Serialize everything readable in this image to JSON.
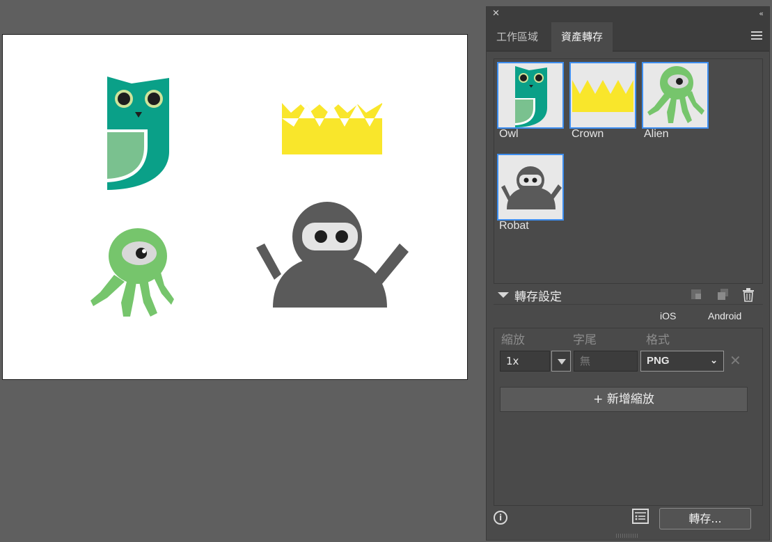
{
  "panel": {
    "tabs": [
      {
        "label": "工作區域",
        "active": false
      },
      {
        "label": "資產轉存",
        "active": true
      }
    ]
  },
  "assets": [
    {
      "label": "Owl",
      "icon": "owl"
    },
    {
      "label": "Crown",
      "icon": "crown"
    },
    {
      "label": "Alien",
      "icon": "alien"
    },
    {
      "label": "Robat",
      "icon": "robot"
    }
  ],
  "export_settings": {
    "title": "轉存設定",
    "platforms": [
      "iOS",
      "Android"
    ],
    "columns": {
      "scale": "縮放",
      "suffix": "字尾",
      "format": "格式"
    },
    "scale_value": "1x",
    "suffix_placeholder": "無",
    "format_value": "PNG",
    "add_scale_label": "+ 新增縮放"
  },
  "footer": {
    "info_icon": "i",
    "export_label": "轉存..."
  },
  "colors": {
    "selection": "#3d8ef0",
    "owl_green": "#0aa088",
    "owl_light": "#7ac18f",
    "crown_yellow": "#f9e62b",
    "alien_green": "#76c56c",
    "robot_gray": "#5a5a5a"
  }
}
